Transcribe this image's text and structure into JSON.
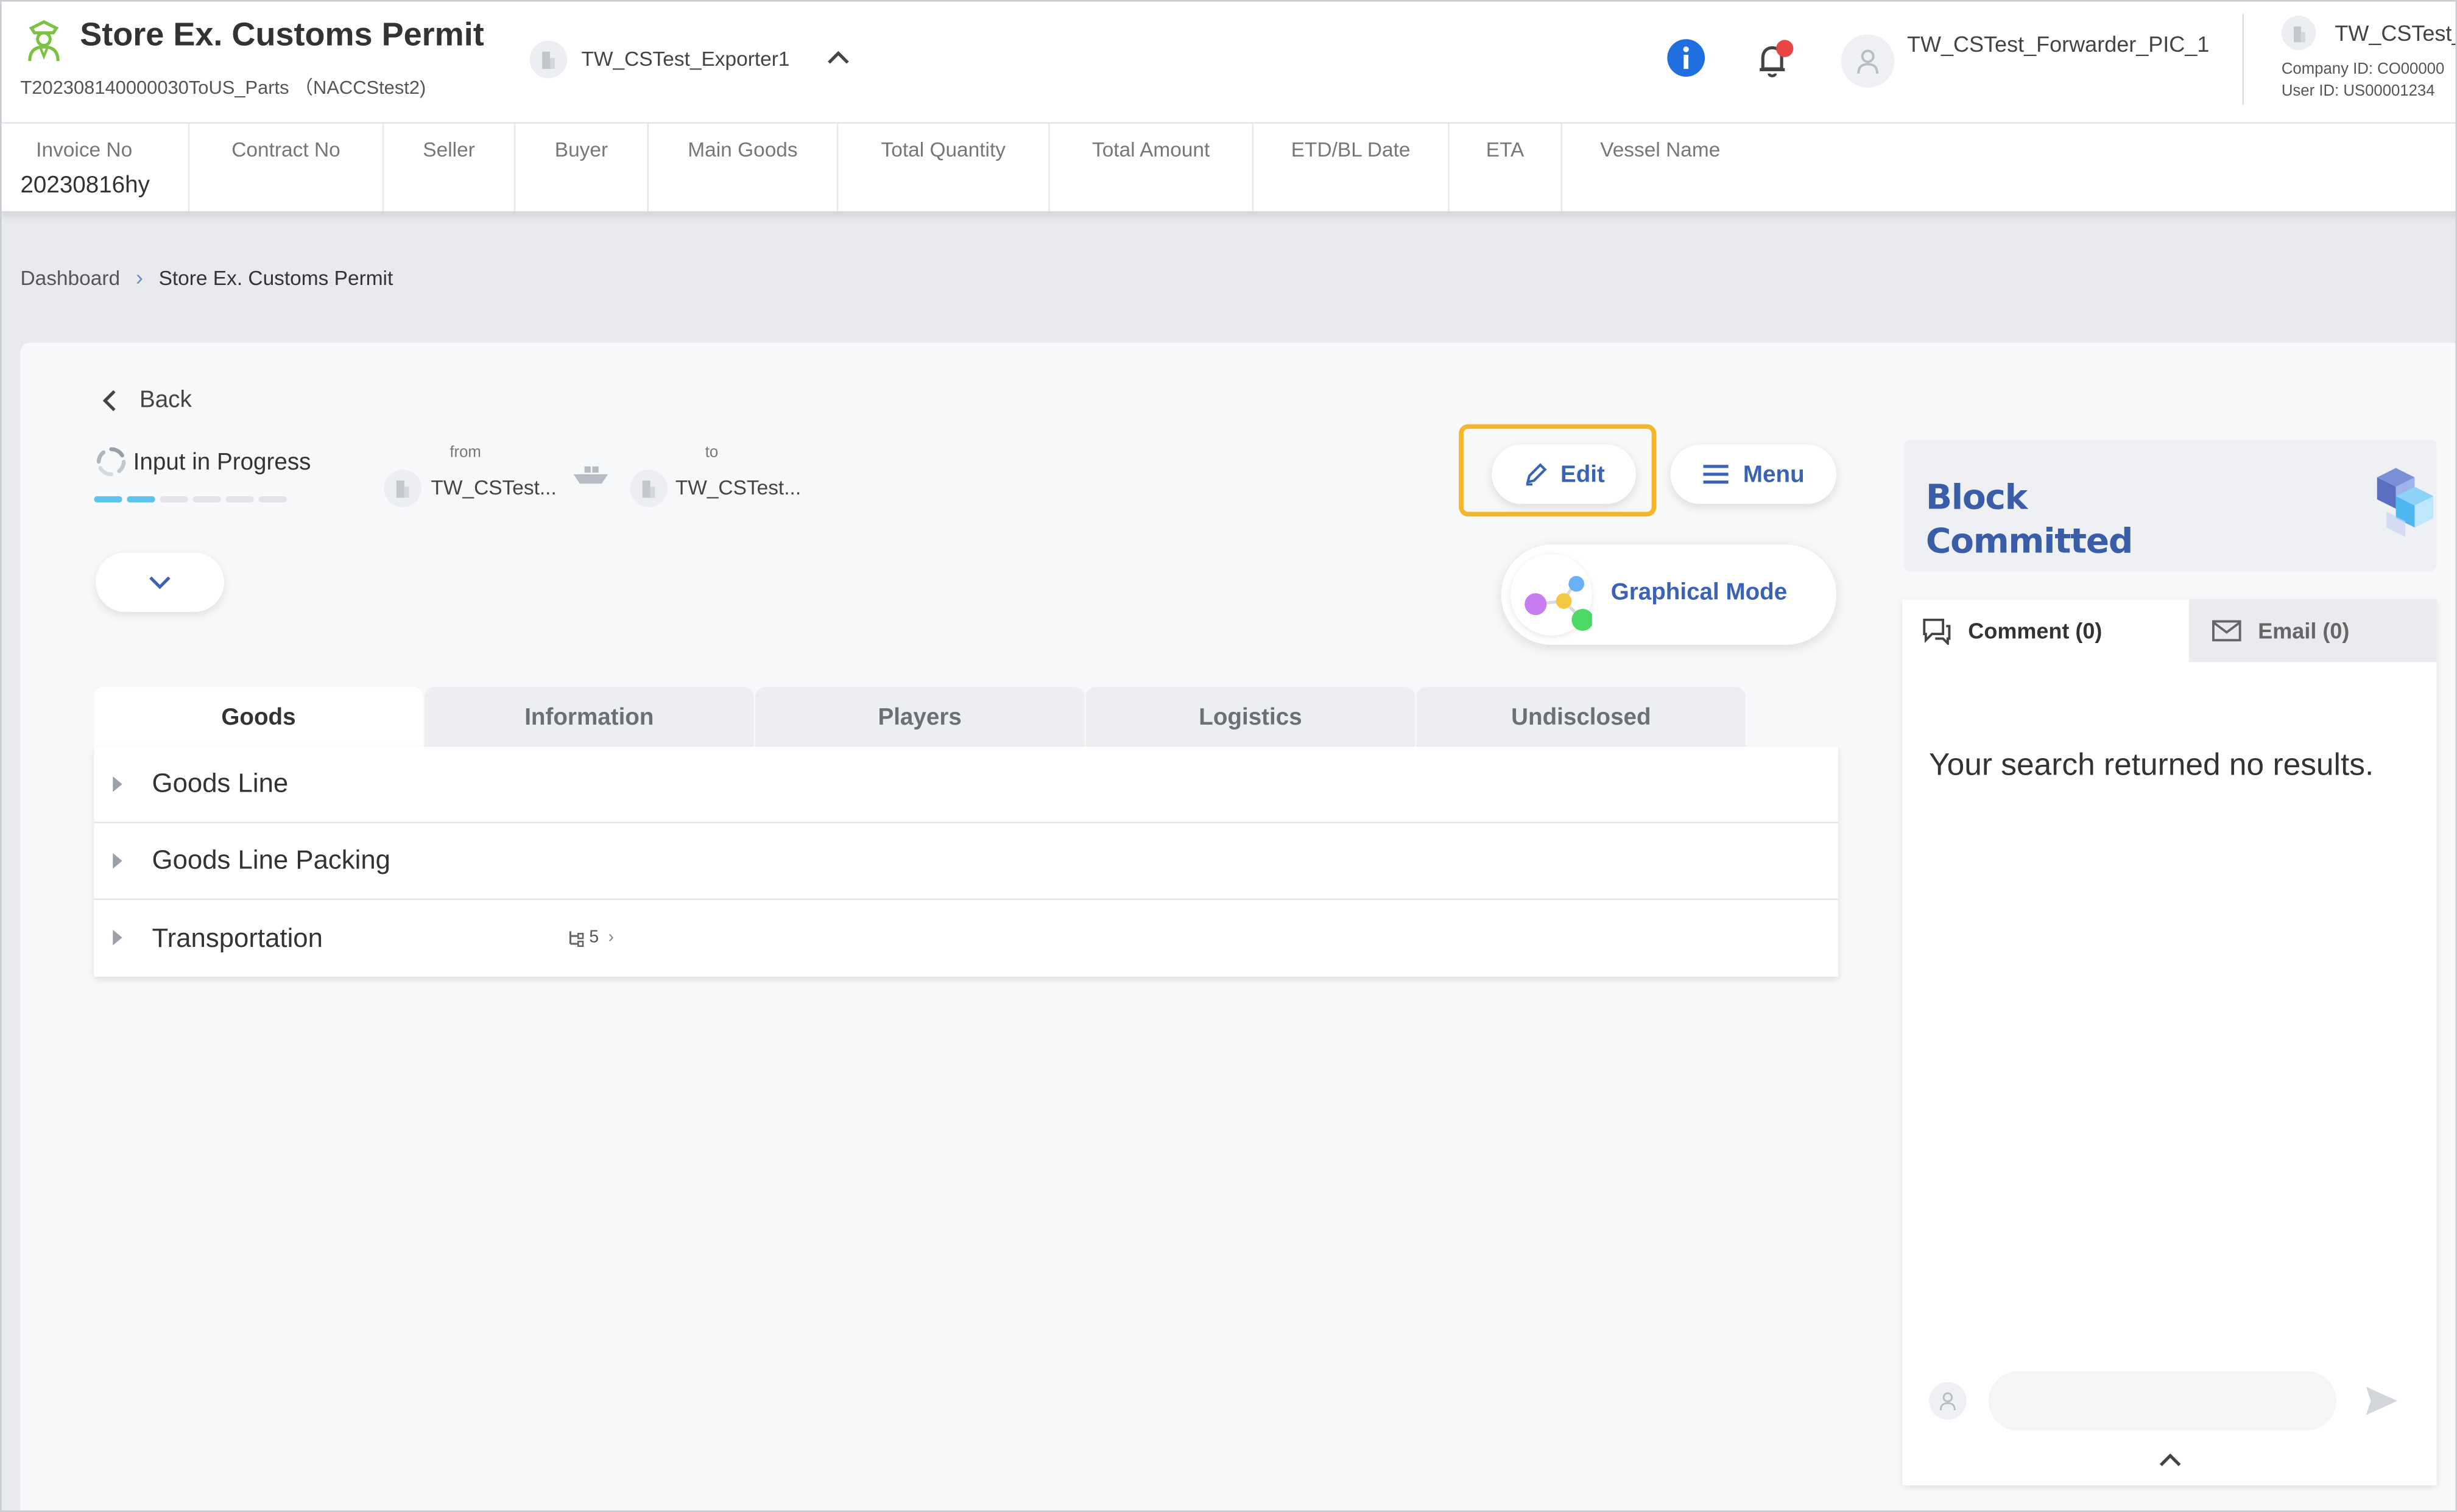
{
  "header": {
    "title": "Store Ex. Customs Permit",
    "subtitle": "T202308140000030ToUS_Parts （NACCStest2)",
    "company_selector": "TW_CSTest_Exporter1",
    "user_name": "TW_CSTest_Forwarder_PIC_1",
    "account_name": "TW_CSTest_",
    "company_id": "Company ID: CO00000",
    "user_id": "User ID: US00001234",
    "colors": {
      "info": "#1f6fe0",
      "notification_dot": "#e84545",
      "logo": "#7cc242"
    }
  },
  "summary": {
    "columns": [
      {
        "label": "Invoice No",
        "value": "20230816hy"
      },
      {
        "label": "Contract No",
        "value": ""
      },
      {
        "label": "Seller",
        "value": ""
      },
      {
        "label": "Buyer",
        "value": ""
      },
      {
        "label": "Main Goods",
        "value": ""
      },
      {
        "label": "Total Quantity",
        "value": ""
      },
      {
        "label": "Total Amount",
        "value": ""
      },
      {
        "label": "ETD/BL Date",
        "value": ""
      },
      {
        "label": "ETA",
        "value": ""
      },
      {
        "label": "Vessel Name",
        "value": ""
      }
    ]
  },
  "breadcrumb": {
    "items": [
      "Dashboard",
      "Store Ex. Customs Permit"
    ],
    "separator": "›"
  },
  "detail": {
    "back_label": "Back",
    "status": "Input in Progress",
    "progress_steps_total": 6,
    "progress_steps_done": 2,
    "route": {
      "from_label": "from",
      "from_name": "TW_CSTest...",
      "to_label": "to",
      "to_name": "TW_CSTest..."
    },
    "edit_label": "Edit",
    "menu_label": "Menu",
    "graphical_mode_label": "Graphical Mode",
    "highlight_color": "#f4b62a",
    "accent_color": "#3b63b5"
  },
  "tabs": [
    {
      "label": "Goods",
      "active": true
    },
    {
      "label": "Information",
      "active": false
    },
    {
      "label": "Players",
      "active": false
    },
    {
      "label": "Logistics",
      "active": false
    },
    {
      "label": "Undisclosed",
      "active": false
    }
  ],
  "goods_rows": [
    {
      "label": "Goods Line",
      "badge": ""
    },
    {
      "label": "Goods Line Packing",
      "badge": ""
    },
    {
      "label": "Transportation",
      "badge_icon": "tree-icon",
      "badge": "5",
      "badge_chevron": "›"
    }
  ],
  "side": {
    "block_status": "Block\nCommitted",
    "comment_tab": "Comment (0)",
    "email_tab": "Email (0)",
    "empty_message": "Your search returned no results.",
    "comment_placeholder": ""
  }
}
